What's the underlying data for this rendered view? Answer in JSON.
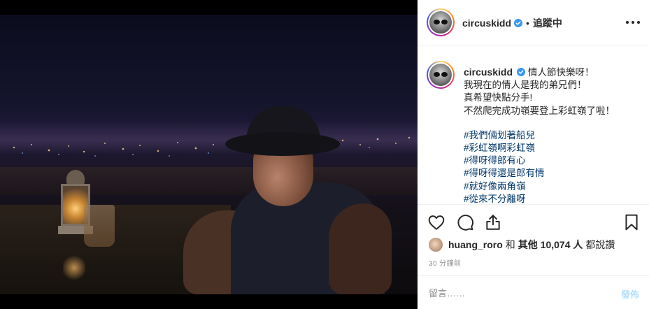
{
  "header": {
    "username": "circuskidd",
    "separator": "•",
    "following_label": "追蹤中"
  },
  "caption": {
    "username": "circuskidd",
    "lines": [
      "情人節快樂呀！",
      "我現在的情人是我的弟兄們！",
      "真希望快點分手!",
      "不然爬完成功嶺要登上彩虹嶺了啦！"
    ],
    "hashtags": [
      "#我們倆划著船兒",
      "#彩虹嶺啊彩虹嶺",
      "#得呀得郎有心",
      "#得呀得還是郎有情",
      "#就好像兩角嶺",
      "#從來不分離呀"
    ]
  },
  "likes": {
    "user": "huang_roro",
    "and_label": "和",
    "others_label": "其他 10,074 人",
    "suffix": "都說讚"
  },
  "timestamp": "30 分鐘前",
  "comment_box": {
    "placeholder": "留言……",
    "post_label": "發佈"
  },
  "colors": {
    "verified": "#3897f0",
    "hashtag": "#00376b",
    "post_disabled": "#b2dffc",
    "muted": "#8e8e8e"
  },
  "icons": [
    "verified-badge-icon",
    "more-options-icon",
    "heart-icon",
    "comment-icon",
    "share-icon",
    "bookmark-icon"
  ]
}
